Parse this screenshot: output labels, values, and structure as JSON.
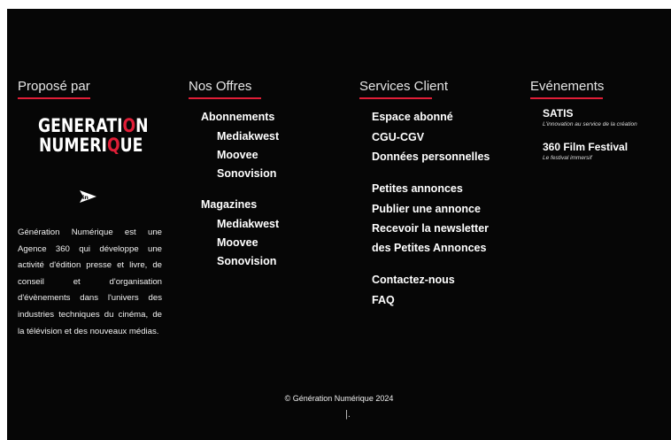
{
  "columns": {
    "propose": {
      "title": "Proposé par"
    },
    "offres": {
      "title": "Nos Offres"
    },
    "services": {
      "title": "Services Client"
    },
    "evenements": {
      "title": "Evénements"
    }
  },
  "logo": {
    "line1_a": "GENERATI",
    "line1_b": "O",
    "line1_c": "N",
    "line2_a": "NUMERI",
    "line2_b": "Q",
    "line2_c": "UE"
  },
  "social": {
    "icon": "linkedin-icon"
  },
  "description": "Génération Numérique est une Agence 360 qui développe une activité d'édition presse et livre, de conseil et d'organisation d'évènements dans l'univers des industries techniques du cinéma, de la télévision et des nouveaux médias.",
  "offres": {
    "abonnements": "Abonnements",
    "abonnements_items": [
      "Mediakwest",
      "Moovee",
      "Sonovision"
    ],
    "magazines": "Magazines",
    "magazines_items": [
      "Mediakwest",
      "Moovee",
      "Sonovision"
    ]
  },
  "services": {
    "items": [
      "Espace abonné",
      "CGU-CGV",
      "Données personnelles",
      "Petites annonces",
      "Publier une annonce",
      "Recevoir la newsletter",
      "des Petites Annonces",
      "Contactez-nous",
      "FAQ"
    ]
  },
  "evenements": {
    "items": [
      {
        "name": "SATIS",
        "tagline": "L'innovation au service de la création"
      },
      {
        "name": "360 Film Festival",
        "tagline": "Le festival immersif"
      }
    ]
  },
  "footer": {
    "copyright": "© Génération Numérique 2024",
    "bar": "|."
  },
  "colors": {
    "accent": "#e01e37",
    "background": "#060606"
  }
}
